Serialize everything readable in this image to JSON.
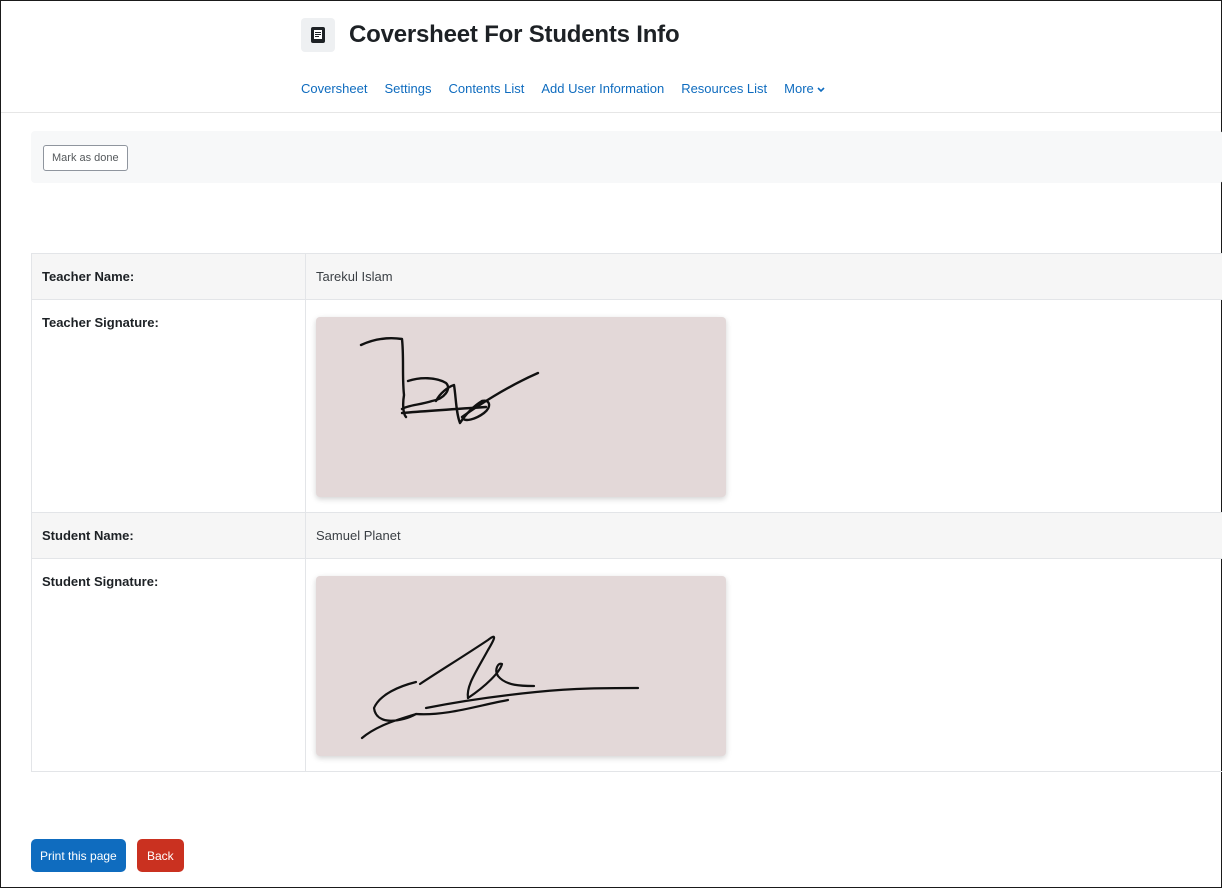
{
  "header": {
    "title": "Coversheet For Students Info",
    "icon": "document-icon"
  },
  "nav": {
    "items": [
      {
        "label": "Coversheet"
      },
      {
        "label": "Settings"
      },
      {
        "label": "Contents List"
      },
      {
        "label": "Add User Information"
      },
      {
        "label": "Resources List"
      },
      {
        "label": "More"
      }
    ]
  },
  "activity": {
    "mark_done_label": "Mark as done"
  },
  "info": {
    "teacher_name_label": "Teacher Name:",
    "teacher_name_value": "Tarekul Islam",
    "teacher_signature_label": "Teacher Signature:",
    "student_name_label": "Student Name:",
    "student_name_value": "Samuel Planet",
    "student_signature_label": "Student Signature:"
  },
  "actions": {
    "print_label": "Print this page",
    "back_label": "Back"
  },
  "colors": {
    "link": "#0f6cbf",
    "primary": "#0f6cbf",
    "danger": "#ca3120",
    "signature_bg": "#e3d8d8"
  }
}
